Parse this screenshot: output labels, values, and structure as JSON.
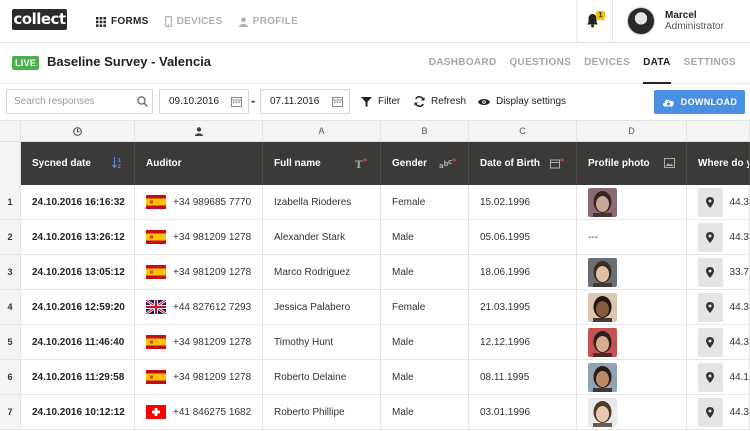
{
  "app": {
    "logo": "collect"
  },
  "nav": {
    "items": [
      {
        "label": "FORMS",
        "icon": "grid-icon",
        "active": true
      },
      {
        "label": "DEVICES",
        "icon": "phone-icon",
        "active": false
      },
      {
        "label": "PROFILE",
        "icon": "user-icon",
        "active": false
      }
    ]
  },
  "notifications": {
    "count": "1"
  },
  "user": {
    "name": "Marcel",
    "role": "Administrator"
  },
  "survey": {
    "status": "LIVE",
    "title": "Baseline Survey - Valencia"
  },
  "tabs": [
    {
      "label": "DASHBOARD",
      "active": false
    },
    {
      "label": "QUESTIONS",
      "active": false
    },
    {
      "label": "DEVICES",
      "active": false
    },
    {
      "label": "DATA",
      "active": true
    },
    {
      "label": "SETTINGS",
      "active": false
    }
  ],
  "toolbar": {
    "search_placeholder": "Search responses",
    "date_from": "09.10.2016",
    "date_separator": "-",
    "date_to": "07.11.2016",
    "filter_label": "Filter",
    "refresh_label": "Refresh",
    "display_label": "Display settings",
    "download_label": "DOWNLOAD"
  },
  "table": {
    "column_letters": [
      "",
      "",
      "",
      "A",
      "B",
      "C",
      "D",
      ""
    ],
    "headers": [
      "",
      "Sycned date",
      "Auditor",
      "Full name",
      "Gender",
      "Date of Birth",
      "Profile photo",
      "Where do y"
    ],
    "rows": [
      {
        "index": "1",
        "date": "24.10.2016 16:16:32",
        "flag": "es",
        "phone": "+34 989685 7770",
        "name": "Izabella Rioderes",
        "gender": "Female",
        "dob": "15.02.1996",
        "photo": "f1",
        "coord": "44.3"
      },
      {
        "index": "2",
        "date": "24.10.2016 13:26:12",
        "flag": "es",
        "phone": "+34 981209 1278",
        "name": "Alexander Stark",
        "gender": "Male",
        "dob": "05.06.1995",
        "photo": "none",
        "photo_text": "---",
        "coord": "44.3"
      },
      {
        "index": "3",
        "date": "24.10.2016 13:05:12",
        "flag": "es",
        "phone": "+34 981209 1278",
        "name": "Marco Rodriguez",
        "gender": "Male",
        "dob": "18.06.1996",
        "photo": "m1",
        "coord": "33.7"
      },
      {
        "index": "4",
        "date": "24.10.2016 12:59:20",
        "flag": "gb",
        "phone": "+44 827612 7293",
        "name": "Jessica Palabero",
        "gender": "Female",
        "dob": "21.03.1995",
        "photo": "f2",
        "coord": "44.3"
      },
      {
        "index": "5",
        "date": "24.10.2016 11:46:40",
        "flag": "es",
        "phone": "+34 981209 1278",
        "name": "Timothy Hunt",
        "gender": "Male",
        "dob": "12.12.1996",
        "photo": "m2",
        "coord": "44.3"
      },
      {
        "index": "6",
        "date": "24.10.2016 11:29:58",
        "flag": "es",
        "phone": "+34 981209 1278",
        "name": "Roberto Delaine",
        "gender": "Male",
        "dob": "08.11.1995",
        "photo": "m3",
        "coord": "44.1"
      },
      {
        "index": "7",
        "date": "24.10.2016 10:12:12",
        "flag": "ch",
        "phone": "+41 846275 1682",
        "name": "Roberto Phillipe",
        "gender": "Male",
        "dob": "03.01.1996",
        "photo": "m4",
        "coord": "44.3"
      }
    ]
  },
  "colors": {
    "live": "#4caf50",
    "download": "#4a90e2",
    "header": "#3b3a38",
    "badge": "#f3c200",
    "required": "#e84c3d"
  }
}
